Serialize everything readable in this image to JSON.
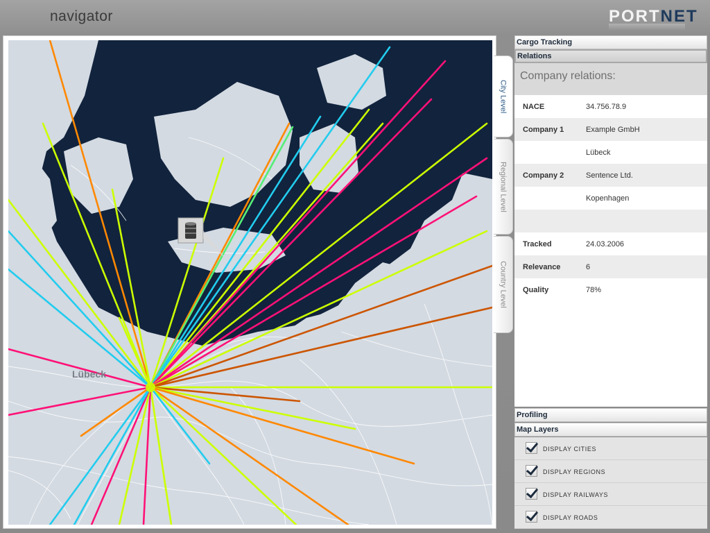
{
  "app": {
    "title": "navigator",
    "logo_part1": "PORT",
    "logo_part2": "NET"
  },
  "map": {
    "city_label": "Lübeck",
    "hub_city": "Lübeck",
    "facility_icon": "oil-barrel-icon",
    "route_colors": {
      "lime": "#ccff00",
      "orange": "#ff8800",
      "magenta": "#ff1177",
      "cyan": "#22ccee",
      "brown": "#cc5500",
      "green": "#55ee77"
    },
    "land_color": "#d3dae2",
    "sea_color": "#12233d"
  },
  "level_tabs": [
    {
      "label": "City Level",
      "active": true
    },
    {
      "label": "Regional Level",
      "active": false
    },
    {
      "label": "Country Level",
      "active": false
    }
  ],
  "panel": {
    "sections": {
      "cargo_tracking": "Cargo Tracking",
      "relations": "Relations",
      "profiling": "Profiling",
      "map_layers": "Map Layers"
    },
    "relations": {
      "heading": "Company relations:",
      "rows": [
        {
          "key": "NACE",
          "value": "34.756.78.9"
        },
        {
          "key": "Company 1",
          "value": "Example GmbH"
        },
        {
          "key": "",
          "value": "Lübeck"
        },
        {
          "key": "Company 2",
          "value": "Sentence Ltd."
        },
        {
          "key": "",
          "value": "Kopenhagen"
        },
        {
          "key": "",
          "value": ""
        },
        {
          "key": "Tracked",
          "value": "24.03.2006"
        },
        {
          "key": "Relevance",
          "value": "6"
        },
        {
          "key": "Quality",
          "value": "78%"
        }
      ]
    },
    "layers": [
      {
        "label": "DISPLAY CITIES",
        "checked": true
      },
      {
        "label": "DISPLAY REGIONS",
        "checked": true
      },
      {
        "label": "DISPLAY RAILWAYS",
        "checked": true
      },
      {
        "label": "DISPLAY ROADS",
        "checked": true
      }
    ]
  }
}
